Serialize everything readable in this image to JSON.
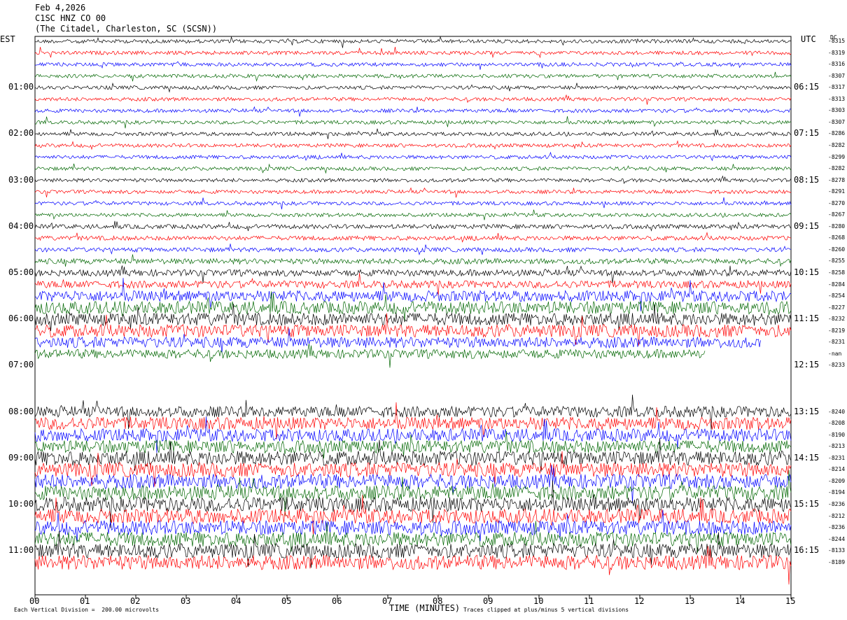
{
  "header": {
    "date": "Feb 4,2026",
    "channel": "C1SC HNZ CO 00",
    "station": "(The Citadel, Charleston, SC (SCSN))"
  },
  "axes": {
    "left_timezone": "EST",
    "right_timezone": "UTC",
    "dc_header": "DC",
    "left_hour_labels": [
      "01:00",
      "02:00",
      "03:00",
      "04:00",
      "05:00",
      "06:00",
      "07:00",
      "08:00",
      "09:00",
      "10:00",
      "11:00"
    ],
    "right_hour_labels": [
      "06:15",
      "07:15",
      "08:15",
      "09:15",
      "10:15",
      "11:15",
      "12:15",
      "13:15",
      "14:15",
      "15:15",
      "16:15"
    ],
    "xlabel": "TIME (MINUTES)"
  },
  "footer": {
    "scale_note": "Each Vertical Division =  200.00 microvolts",
    "clip_note": "Traces clipped at plus/minus 5 vertical divisions"
  },
  "colors": {
    "black": "#000000",
    "red": "#ff0000",
    "blue": "#0000ff",
    "green": "#006600"
  },
  "chart_data": {
    "type": "line",
    "title": "C1SC HNZ CO 00",
    "xlabel": "TIME (MINUTES)",
    "x_ticks": [
      "00",
      "01",
      "02",
      "03",
      "04",
      "05",
      "06",
      "07",
      "08",
      "09",
      "10",
      "11",
      "12",
      "13",
      "14",
      "15"
    ],
    "xlim": [
      0,
      15
    ],
    "minutes_per_line": 15,
    "color_cycle": [
      "black",
      "red",
      "blue",
      "green"
    ],
    "dc_offsets": [
      "-8315",
      "-8319",
      "-8316",
      "-8307",
      "-8317",
      "-8313",
      "-8303",
      "-8307",
      "-8286",
      "-8282",
      "-8299",
      "-8282",
      "-8278",
      "-8291",
      "-8270",
      "-8267",
      "-8280",
      "-8268",
      "-8260",
      "-8255",
      "-8258",
      "-8284",
      "-8254",
      "-8227",
      "-8232",
      "-8219",
      "-8231",
      "-nan",
      "-8233",
      "",
      "",
      "",
      "-8240",
      "-8208",
      "-8190",
      "-8213",
      "-8231",
      "-8214",
      "-8209",
      "-8194",
      "-8236",
      "-8212",
      "-8236",
      "-8244",
      "-8133",
      "-8189"
    ],
    "trace_amplitude": [
      1,
      1,
      1,
      1,
      1,
      1,
      1,
      1,
      1,
      1,
      1,
      1,
      1,
      1,
      1,
      1,
      1.2,
      1.2,
      1.2,
      1.5,
      1.8,
      2,
      3,
      3.5,
      3.5,
      3.5,
      3,
      2.5,
      0,
      0,
      0,
      0,
      3,
      3.5,
      3.5,
      3.5,
      4,
      4,
      4,
      4,
      4,
      4,
      4,
      4,
      4,
      4
    ],
    "trace_end_minute": [
      15,
      15,
      15,
      15,
      15,
      15,
      15,
      15,
      15,
      15,
      15,
      15,
      15,
      15,
      15,
      15,
      15,
      15,
      15,
      15,
      15,
      15,
      15,
      15,
      15,
      15,
      14.4,
      13.3,
      0,
      0,
      0,
      15,
      15,
      15,
      15,
      15,
      15,
      15,
      15,
      15,
      15,
      15,
      15,
      15,
      15,
      15
    ]
  }
}
